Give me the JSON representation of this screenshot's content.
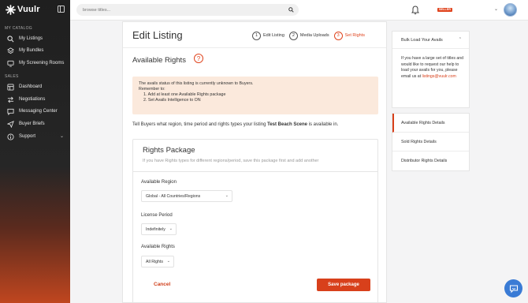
{
  "sidebar": {
    "brand": "Vuulr",
    "sections": [
      {
        "label": "MY CATALOG",
        "items": [
          {
            "label": "My Listings",
            "icon": "search-icon"
          },
          {
            "label": "My Bundles",
            "icon": "layers-icon"
          },
          {
            "label": "My Screening Rooms",
            "icon": "monitor-icon"
          }
        ]
      },
      {
        "label": "SALES",
        "items": [
          {
            "label": "Dashboard",
            "icon": "dashboard-icon"
          },
          {
            "label": "Negotiations",
            "icon": "arrows-icon"
          },
          {
            "label": "Messaging Center",
            "icon": "chat-icon"
          },
          {
            "label": "Buyer Briefs",
            "icon": "send-icon"
          },
          {
            "label": "Support",
            "icon": "info-icon"
          }
        ]
      }
    ]
  },
  "topbar": {
    "search_placeholder": "browse titles...",
    "role_badge": "SELLER"
  },
  "main": {
    "title": "Edit Listing",
    "steps": [
      {
        "num": "1",
        "label": "Edit Listing"
      },
      {
        "num": "2",
        "label": "Media Uploads"
      },
      {
        "num": "3",
        "label": "Set Rights"
      }
    ],
    "section_title": "Available Rights",
    "help_glyph": "?",
    "alert": {
      "line1": "The avails status of this listing is currently unknown to Buyers.",
      "line2": "Remember to:",
      "item1": "1. Add at least one Available Rights package",
      "item2": "2. Set Avails Intelligence to ON"
    },
    "tell_prefix": "Tell Buyers what region, time period and rights types your listing ",
    "tell_title": "Test Beach Scene",
    "tell_suffix": " is available in.",
    "package": {
      "title": "Rights Package",
      "subtitle": "If you have Rights types for different regions/period, save this package first and add another",
      "region_label": "Available Region",
      "region_value": "Global - All Countries/Regions",
      "period_label": "License Period",
      "period_value": "Indefinitely",
      "rights_label": "Available Rights",
      "rights_value": "All Rights",
      "cancel": "Cancel",
      "save": "Save package"
    }
  },
  "right": {
    "bulk_title": "Bulk Load Your Avails",
    "bulk_text": "If you have a large set of titles and would like to request our help to load your avails for you, please email us at",
    "bulk_email": "listings@vuulr.com",
    "nav": [
      "Available Rights Details",
      "Sold Rights Details",
      "Distributor Rights Details"
    ]
  },
  "colors": {
    "accent": "#d8401b",
    "chat": "#3a7bd5"
  }
}
